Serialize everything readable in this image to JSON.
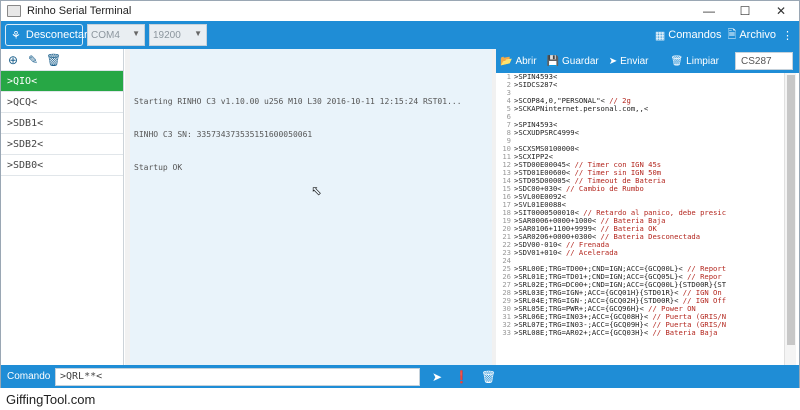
{
  "window": {
    "title": "Rinho Serial Terminal"
  },
  "toolbar": {
    "connect_label": "Desconectar",
    "port_value": "COM4",
    "baud_value": "19200",
    "commands_label": "Comandos",
    "file_label": "Archivo"
  },
  "left": {
    "items": [
      ">QIO<",
      ">QCQ<",
      ">SDB1<",
      ">SDB2<",
      ">SDB0<"
    ]
  },
  "terminal": {
    "lines": [
      "Starting RINHO C3 v1.10.00 u256 M10 L30 2016-10-11 12:15:24 RST01...",
      "RINHO C3 SN: 335734373535151600050061",
      "Startup OK"
    ]
  },
  "right": {
    "open_label": "Abrir",
    "save_label": "Guardar",
    "send_label": "Enviar",
    "clear_label": "Limpiar",
    "device_value": "CS287",
    "lines": [
      ">SPIN4593<",
      ">SIDCS287<",
      "",
      ">SCOP84,0,\"PERSONAL\"< // 2g",
      ">SCKAPNinternet.personal.com,,<",
      "",
      ">SPIN4593<",
      ">SCXUDPSRC4999<",
      "",
      ">SCXSMS0100000<",
      ">SCXIPP2<",
      ">STD00E00045< // Timer con IGN 45s",
      ">STD01E00600< // Timer sin IGN 50m",
      ">STD05D00005< // Timeout de Bateria",
      ">SDC00+030< // Cambio de Rumbo",
      ">SVL00E0092<",
      ">SVL01E0088<",
      ">SIT0000500010< // Retardo al panico, debe presic",
      ">SAR0006+0000+1000< // Bateria Baja",
      ">SAR0106+1100+9999< // Bateria OK",
      ">SAR0206+0000+0300< // Bateria Desconectada",
      ">SDV00-010< // Frenada",
      ">SDV01+010< // Acelerada",
      "",
      ">SRL00E;TRG=TD00+;CND=IGN;ACC={GCQ00L}< // Report",
      ">SRL01E;TRG=TD01+;CND=IGN;ACC={GCQ05L}< // Repor",
      ">SRL02E;TRG=DC00+;CND=IGN;ACC={GCQ00L}{STD00R}{ST",
      ">SRL03E;TRG=IGN+;ACC={GCQ01H}{STD01R}< // IGN On",
      ">SRL04E;TRG=IGN-;ACC={GCQ02H}{STD00R}< // IGN Off",
      ">SRL05E;TRG=PWR+;ACC={GCQ96H}< // Power ON",
      ">SRL06E;TRG=IN03+;ACC={GCQ08H}< // Puerta (GRIS/N",
      ">SRL07E;TRG=IN03-;ACC={GCQ09H}< // Puerta (GRIS/N",
      ">SRL08E;TRG=AR02+;ACC={GCQ03H}< // Bateria Baja"
    ]
  },
  "bottom": {
    "command_label": "Comando",
    "command_value": ">QRL**<"
  },
  "watermark": "GiffingTool.com"
}
